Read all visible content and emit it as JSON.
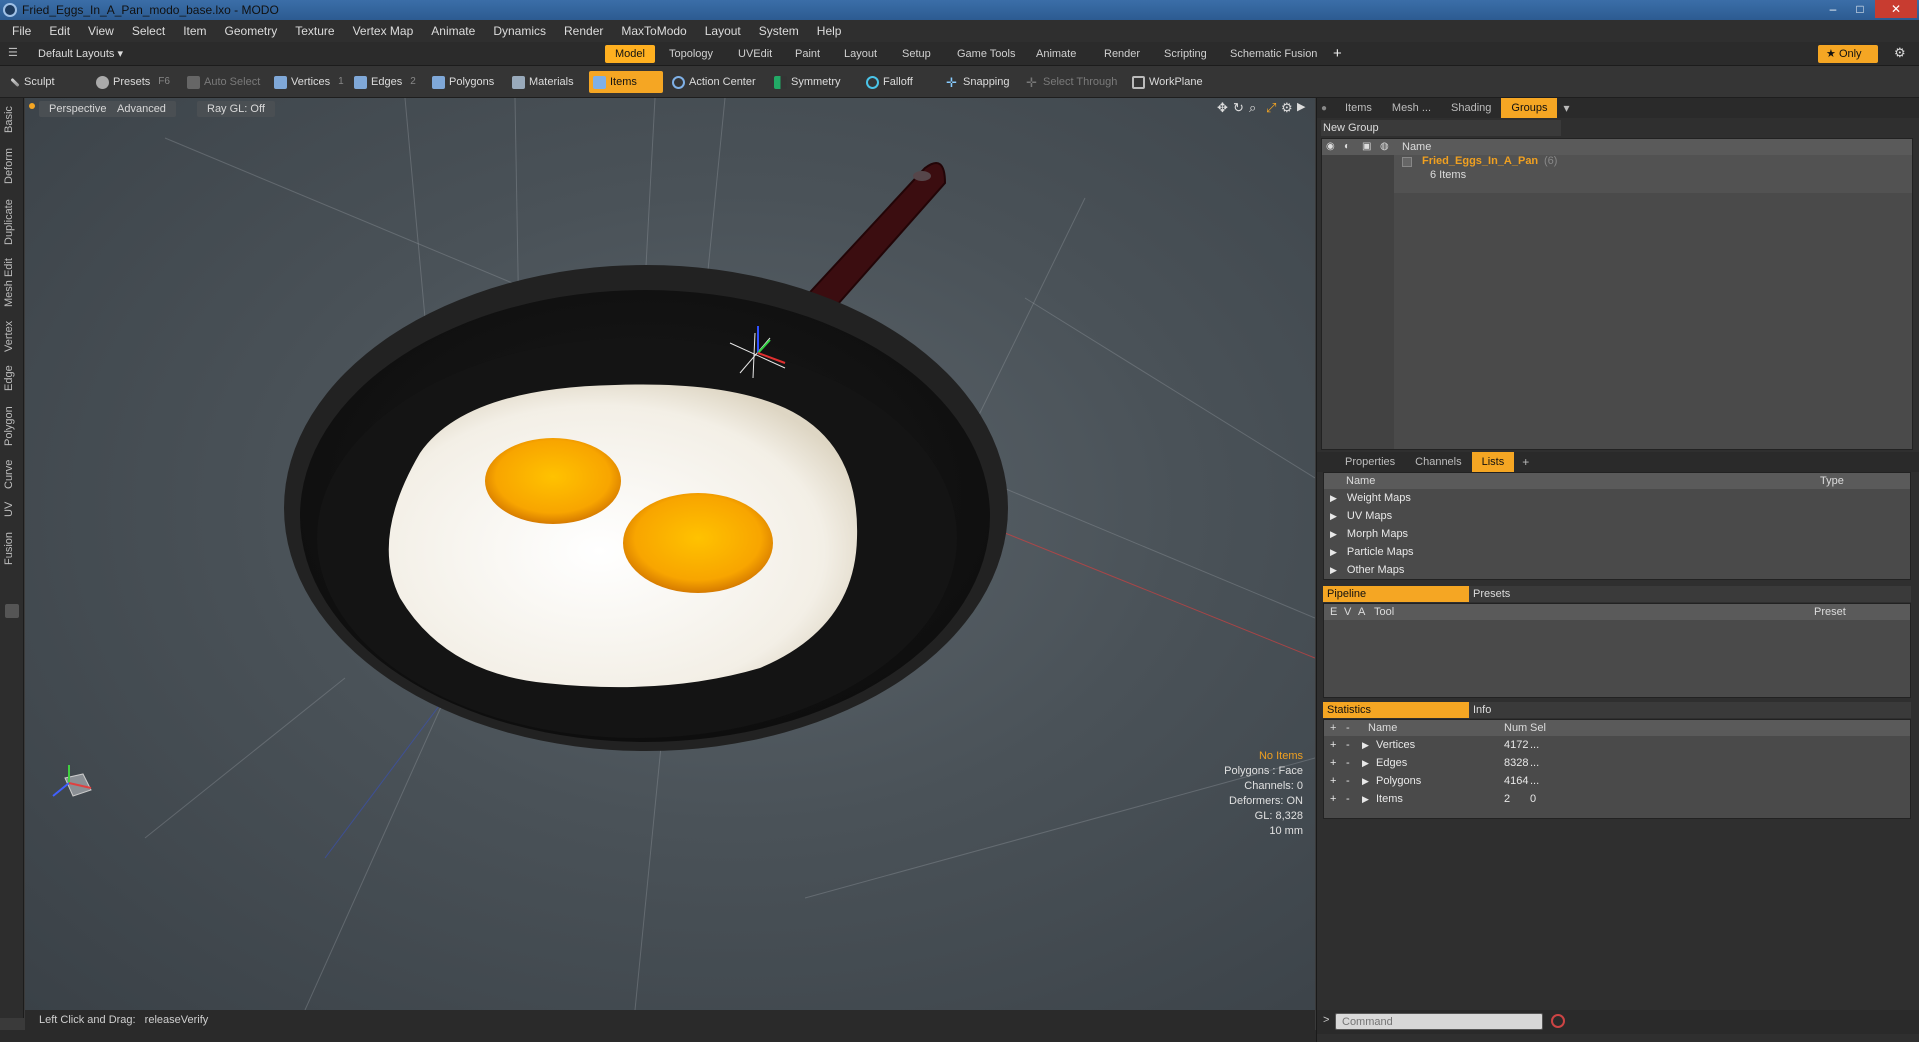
{
  "window": {
    "title": "Fried_Eggs_In_A_Pan_modo_base.lxo - MODO",
    "minimize": "–",
    "maximize": "□",
    "close": "✕"
  },
  "menu": [
    "File",
    "Edit",
    "View",
    "Select",
    "Item",
    "Geometry",
    "Texture",
    "Vertex Map",
    "Animate",
    "Dynamics",
    "Render",
    "MaxToModo",
    "Layout",
    "System",
    "Help"
  ],
  "layoutbar": {
    "layout_dropdown": "Default Layouts ▾",
    "tabs": [
      "Model",
      "Topology",
      "UVEdit",
      "Paint",
      "Layout",
      "Setup",
      "Game Tools",
      "Animate",
      "Render",
      "Scripting",
      "Schematic Fusion"
    ],
    "active_tab": "Model",
    "add": "+",
    "only_label": "Only",
    "star": "★",
    "gear": "⚙"
  },
  "toolbar": {
    "sculpt": "Sculpt",
    "presets": "Presets",
    "presets_key": "F6",
    "auto_select": "Auto Select",
    "vertices": "Vertices",
    "vertices_key": "1",
    "edges": "Edges",
    "edges_key": "2",
    "polygons": "Polygons",
    "materials": "Materials",
    "items": "Items",
    "action_center": "Action Center",
    "symmetry": "Symmetry",
    "falloff": "Falloff",
    "snapping": "Snapping",
    "select_through": "Select Through",
    "workplane": "WorkPlane"
  },
  "left_tabs": [
    "Basic",
    "Deform",
    "Duplicate",
    "Mesh Edit",
    "Vertex",
    "Edge",
    "Polygon",
    "Curve",
    "UV",
    "Fusion"
  ],
  "viewport": {
    "perspective": "Perspective",
    "advanced": "Advanced",
    "raygl": "Ray GL: Off",
    "hud": {
      "no_items": "No Items",
      "polygons": "Polygons : Face",
      "channels": "Channels: 0",
      "deformers": "Deformers: ON",
      "gl": "GL: 8,328",
      "scale": "10 mm"
    }
  },
  "status": {
    "hint_label": "Left Click and Drag:",
    "hint_value": "releaseVerify"
  },
  "groups_panel": {
    "tabs": [
      "Items",
      "Mesh ...",
      "Shading",
      "Groups"
    ],
    "active_tab": "Groups",
    "new_group": "New Group",
    "name_header": "Name",
    "group_name": "Fried_Eggs_In_A_Pan",
    "group_count": "(6)",
    "group_items": "6 Items"
  },
  "lists_panel": {
    "tabs": [
      "Properties",
      "Channels",
      "Lists"
    ],
    "active_tab": "Lists",
    "add": "+",
    "headers": [
      "Name",
      "Type"
    ],
    "rows": [
      "Weight Maps",
      "UV Maps",
      "Morph Maps",
      "Particle Maps",
      "Other Maps"
    ]
  },
  "pipeline_panel": {
    "tabs": [
      "Pipeline",
      "Presets"
    ],
    "active_tab": "Pipeline",
    "headers": [
      "E",
      "V",
      "A",
      "Tool",
      "Preset"
    ]
  },
  "stats_panel": {
    "tabs": [
      "Statistics",
      "Info"
    ],
    "active_tab": "Statistics",
    "headers": [
      "+",
      "-",
      "Name",
      "Num",
      "Sel"
    ],
    "rows": [
      {
        "name": "Vertices",
        "num": "4172",
        "sel": "..."
      },
      {
        "name": "Edges",
        "num": "8328",
        "sel": "..."
      },
      {
        "name": "Polygons",
        "num": "4164",
        "sel": "..."
      },
      {
        "name": "Items",
        "num": "2",
        "sel": "0"
      }
    ]
  },
  "command": {
    "prompt": ">",
    "placeholder": "Command"
  },
  "colors": {
    "accent": "#f5a623",
    "group_name": "#f0a020"
  }
}
